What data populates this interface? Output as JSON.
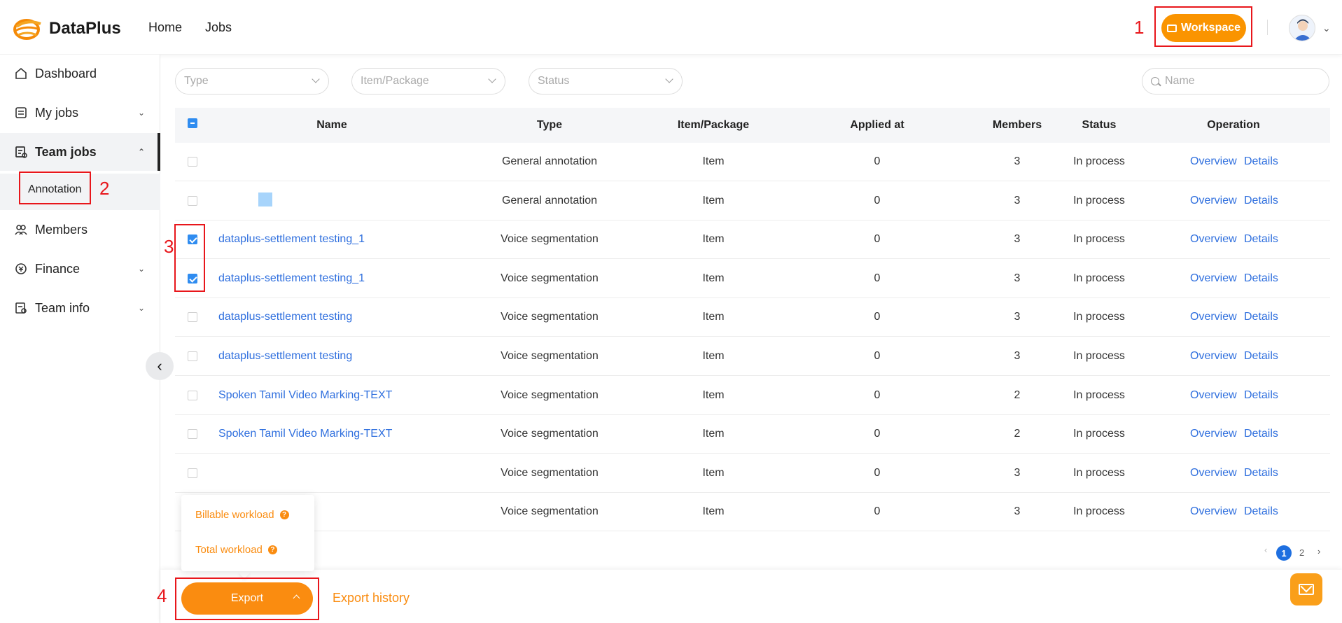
{
  "header": {
    "brand": "DataPlus",
    "nav": [
      "Home",
      "Jobs"
    ],
    "workspace_label": "Workspace"
  },
  "sidebar": {
    "items": [
      {
        "label": "Dashboard",
        "icon": "home-icon"
      },
      {
        "label": "My jobs",
        "icon": "jobs-icon"
      },
      {
        "label": "Team jobs",
        "icon": "team-jobs-icon"
      },
      {
        "label": "Members",
        "icon": "members-icon"
      },
      {
        "label": "Finance",
        "icon": "finance-icon"
      },
      {
        "label": "Team info",
        "icon": "team-info-icon"
      }
    ],
    "sub_item": "Annotation"
  },
  "filters": {
    "type": "Type",
    "item_package": "Item/Package",
    "status": "Status",
    "name_placeholder": "Name"
  },
  "table": {
    "headers": [
      "Name",
      "Type",
      "Item/Package",
      "Applied at",
      "Members",
      "Status",
      "Operation"
    ],
    "rows": [
      {
        "name": "",
        "type": "General annotation",
        "item": "Item",
        "applied": "0",
        "members": "3",
        "status": "In process",
        "checked": false
      },
      {
        "name": "",
        "type": "General annotation",
        "item": "Item",
        "applied": "0",
        "members": "3",
        "status": "In process",
        "checked": false
      },
      {
        "name": "dataplus-settlement testing_1",
        "type": "Voice segmentation",
        "item": "Item",
        "applied": "0",
        "members": "3",
        "status": "In process",
        "checked": true
      },
      {
        "name": "dataplus-settlement testing_1",
        "type": "Voice segmentation",
        "item": "Item",
        "applied": "0",
        "members": "3",
        "status": "In process",
        "checked": true
      },
      {
        "name": "dataplus-settlement testing",
        "type": "Voice segmentation",
        "item": "Item",
        "applied": "0",
        "members": "3",
        "status": "In process",
        "checked": false
      },
      {
        "name": "dataplus-settlement testing",
        "type": "Voice segmentation",
        "item": "Item",
        "applied": "0",
        "members": "3",
        "status": "In process",
        "checked": false
      },
      {
        "name": "Spoken Tamil Video Marking-TEXT",
        "type": "Voice segmentation",
        "item": "Item",
        "applied": "0",
        "members": "2",
        "status": "In process",
        "checked": false
      },
      {
        "name": "Spoken Tamil Video Marking-TEXT",
        "type": "Voice segmentation",
        "item": "Item",
        "applied": "0",
        "members": "2",
        "status": "In process",
        "checked": false
      },
      {
        "name": "",
        "type": "Voice segmentation",
        "item": "Item",
        "applied": "0",
        "members": "3",
        "status": "In process",
        "checked": false
      },
      {
        "name": "",
        "type": "Voice segmentation",
        "item": "Item",
        "applied": "0",
        "members": "3",
        "status": "In process",
        "checked": false
      }
    ],
    "op_overview": "Overview",
    "op_details": "Details"
  },
  "pagination": {
    "current": "1",
    "next_page": "2",
    "prev_glyph": "‹",
    "next_glyph": "›"
  },
  "export": {
    "button_label": "Export",
    "history_label": "Export history",
    "menu": [
      "Billable workload",
      "Total workload"
    ],
    "help_glyph": "?"
  },
  "annotations": [
    "1",
    "2",
    "3",
    "4"
  ],
  "colors": {
    "accent": "#fa8c10",
    "link": "#2f6fde",
    "highlight": "#e8161b"
  }
}
